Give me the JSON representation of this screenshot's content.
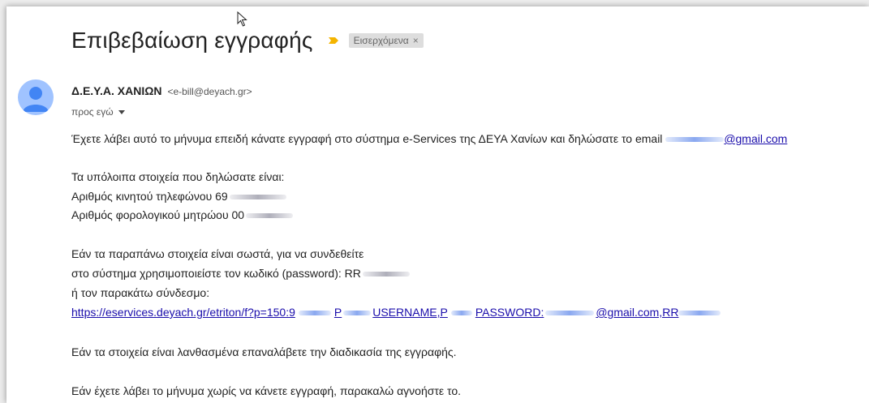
{
  "email": {
    "subject": "Επιβεβαίωση εγγραφής",
    "label": "Εισερχόμενα",
    "label_remove": "×",
    "sender_name": "Δ.Ε.Υ.Α. ΧΑΝΙΩΝ",
    "sender_email": "<e-bill@deyach.gr>",
    "to_text": "προς εγώ",
    "intro_text": "Έχετε λάβει αυτό το μήνυμα επειδή κάνατε εγγραφή στο σύστημα e-Services της ΔΕΥΑ Χανίων και δηλώσατε το email ",
    "intro_email": "@gmail.com",
    "other_details_heading": "Τα υπόλοιπα στοιχεία που δηλώσατε είναι:",
    "phone_label": "Αριθμός κινητού τηλεφώνου 69",
    "tax_label": "Αριθμός φορολογικού μητρώου 00",
    "instructions_line1": "Εάν τα παραπάνω στοιχεία είναι σωστά, για να συνδεθείτε",
    "instructions_line2": "στο σύστημα χρησιμοποιείστε τον κωδικό (password): RR",
    "instructions_line3": "ή τον παρακάτω σύνδεσμο:",
    "link_part1": "https://eservices.deyach.gr/etriton/f?p=150:9",
    "link_part2": "P",
    "link_part3": "USERNAME,P",
    "link_part4": "PASSWORD:",
    "link_part5": "@gmail.com,RR",
    "wrong_details_text": "Εάν τα στοιχεία είναι λανθασμένα επαναλάβετε την διαδικασία της εγγραφής.",
    "ignore_text": "Εάν έχετε λάβει το μήνυμα χωρίς να κάνετε εγγραφή, παρακαλώ αγνοήστε το."
  },
  "colors": {
    "importance_marker": "#f4b400",
    "avatar_bg": "#a0c3ff",
    "avatar_fg": "#4285f4",
    "link": "#1a0dab"
  }
}
